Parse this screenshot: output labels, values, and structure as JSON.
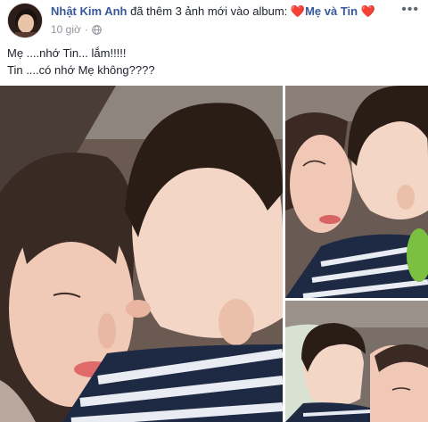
{
  "post": {
    "author": "Nhật Kim Anh",
    "action": "đã thêm 3 ảnh mới vào album:",
    "album_name": "Mẹ và Tin",
    "heart_glyph": "❤️",
    "timestamp": "10 giờ",
    "privacy_icon": "globe-icon",
    "more_glyph": "•••",
    "caption_lines": [
      "Mẹ ....nhớ Tin... lắm!!!!!",
      "Tin ....có nhớ Mẹ không????"
    ]
  },
  "colors": {
    "link": "#385898",
    "muted": "#90949c",
    "heart": "#e0245e"
  },
  "photos": [
    {
      "name": "photo-main",
      "subject": "mother-kissing-child"
    },
    {
      "name": "photo-top-right",
      "subject": "mother-kissing-child"
    },
    {
      "name": "photo-bottom-right",
      "subject": "mother-and-child"
    }
  ]
}
